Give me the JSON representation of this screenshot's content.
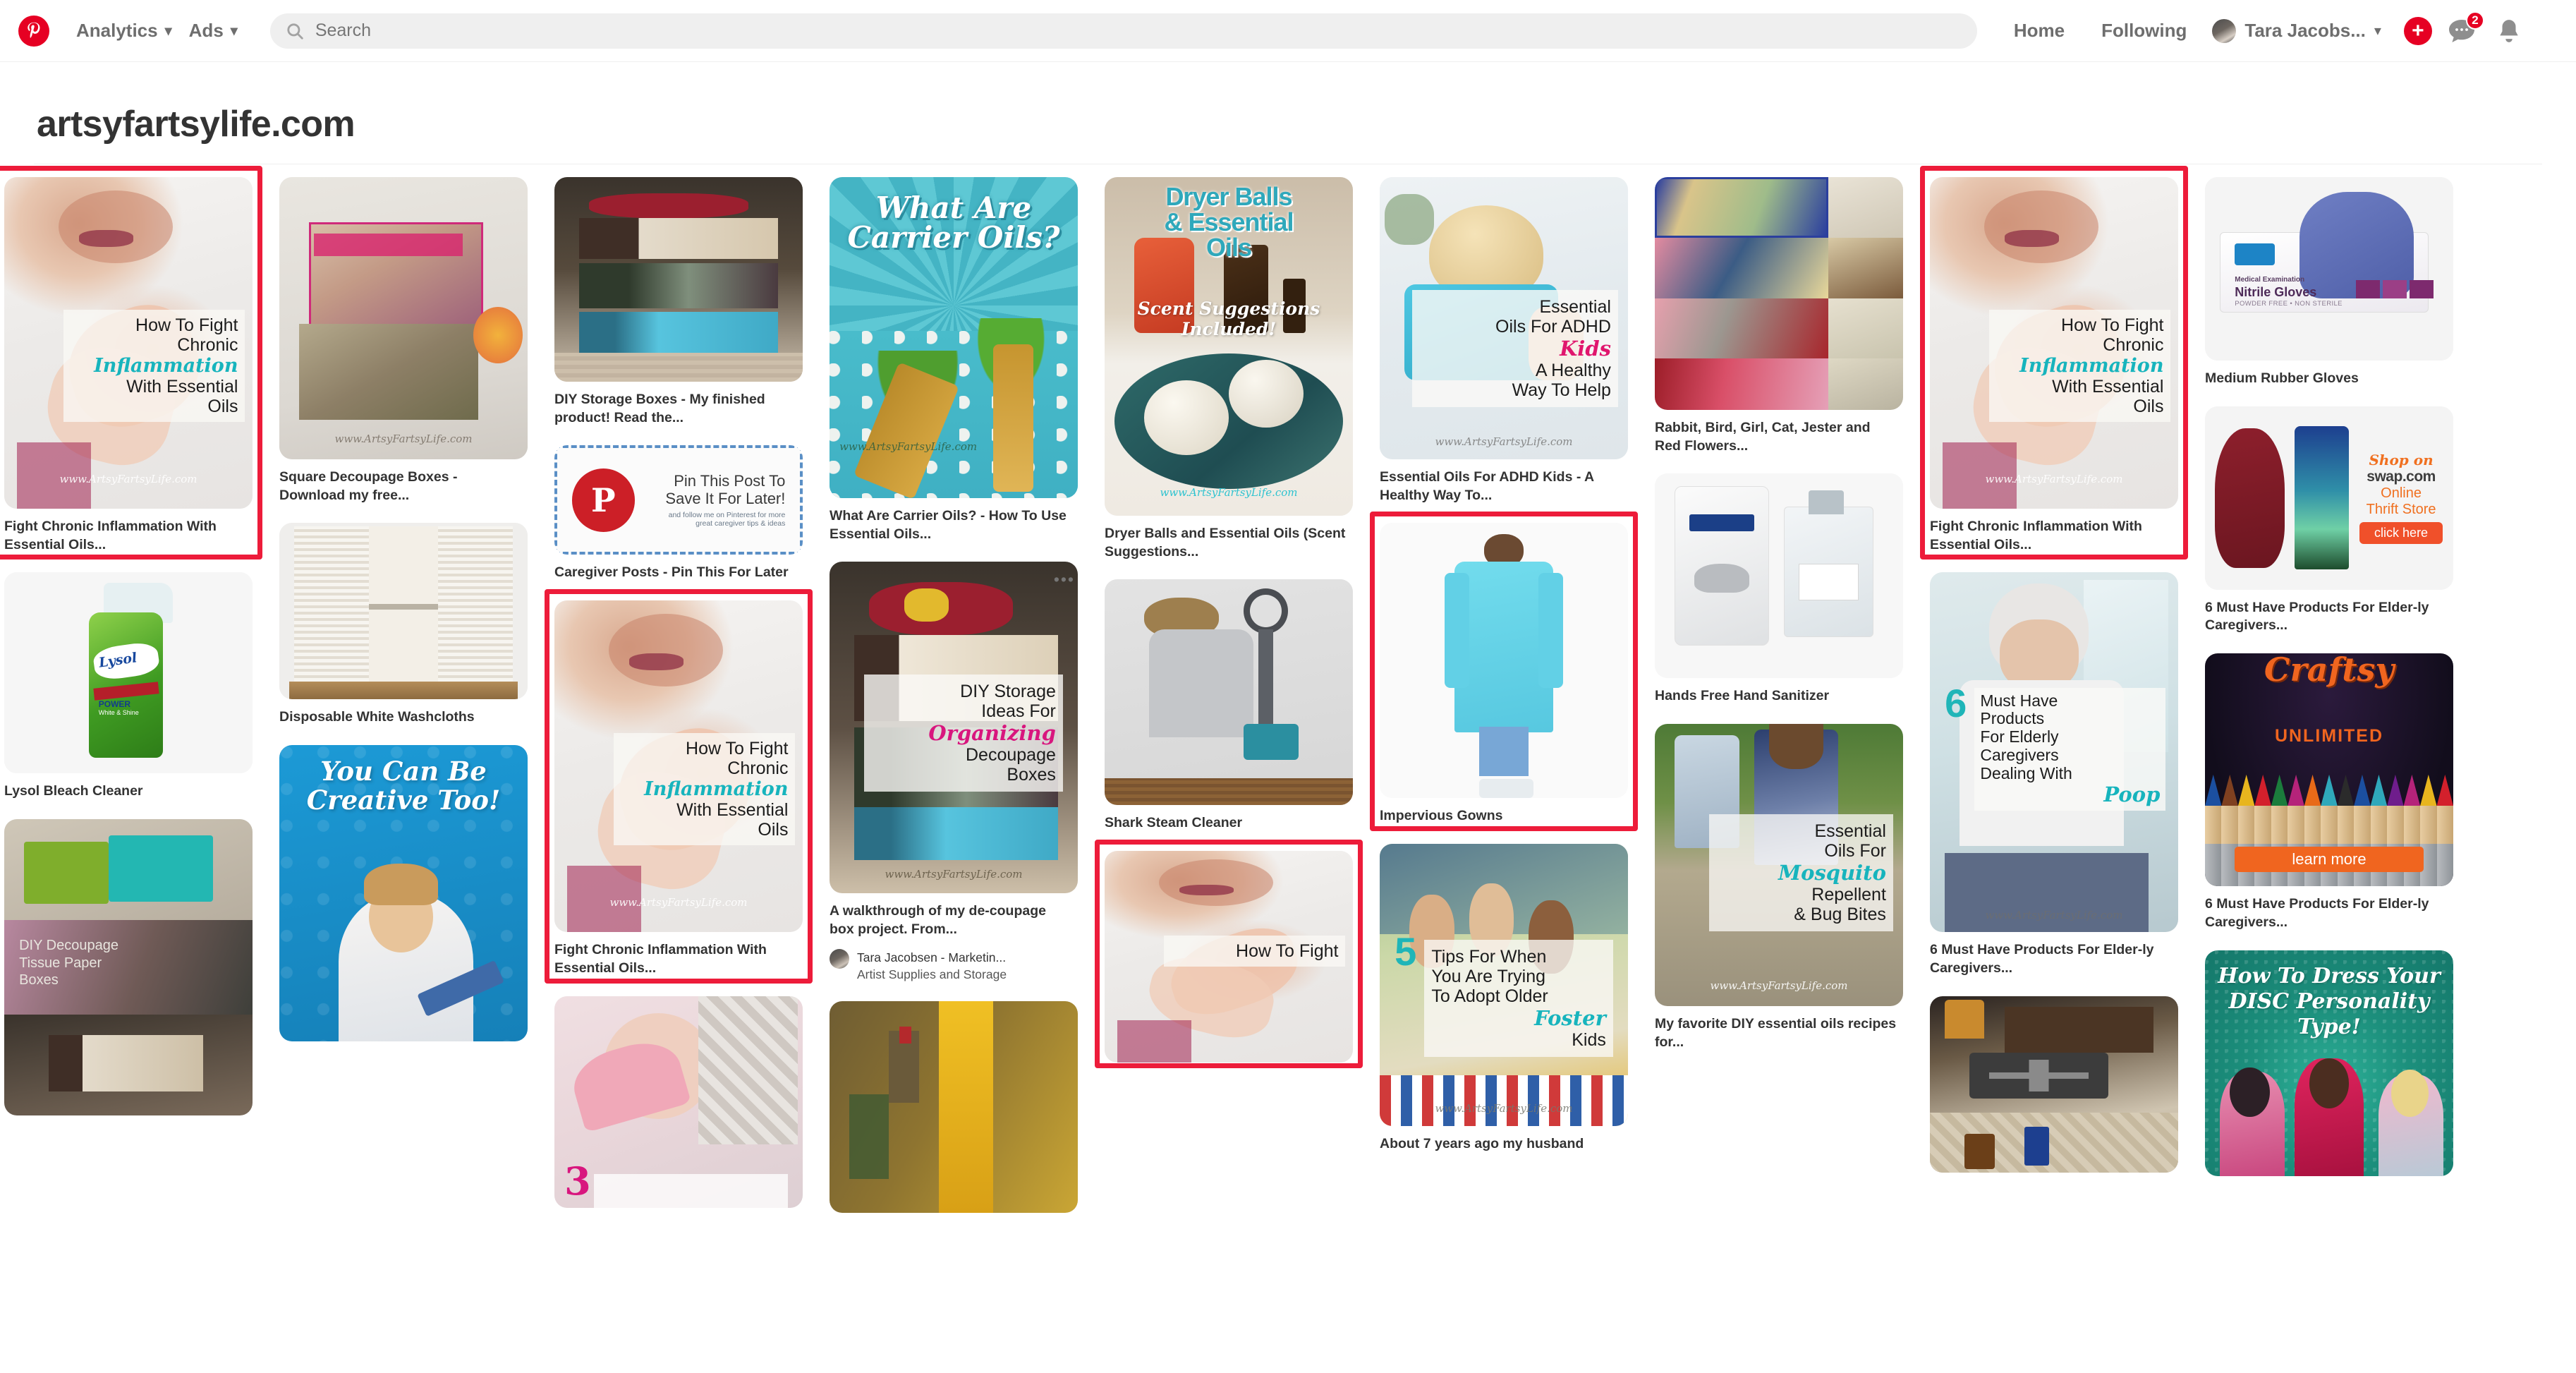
{
  "header": {
    "logo_alt": "Pinterest",
    "nav": [
      {
        "label": "Analytics",
        "has_caret": true
      },
      {
        "label": "Ads",
        "has_caret": true
      }
    ],
    "search": {
      "placeholder": "Search",
      "value": ""
    },
    "right_links": [
      "Home",
      "Following"
    ],
    "account": {
      "name": "Tara Jacobs...",
      "has_caret": true
    },
    "create_button_label": "+",
    "messages_badge": "2"
  },
  "board": {
    "title": "artsyfartsylife.com"
  },
  "columns": [
    {
      "pins": [
        {
          "title": "Fight Chronic Inflammation With Essential Oils...",
          "art": "inflammation",
          "highlight": "outer",
          "overlay": {
            "line1": "How To Fight",
            "line2": "Chronic",
            "script": "Inflammation",
            "line3": "With Essential",
            "line4": "Oils",
            "watermark": "www.ArtsyFartsyLife.com"
          }
        },
        {
          "title": "Lysol Bleach Cleaner",
          "art": "lysol"
        },
        {
          "title": "",
          "art": "decoupage-tissue"
        }
      ]
    },
    {
      "pins": [
        {
          "title": "Square Decoupage Boxes - Download my free...",
          "art": "square-boxes"
        },
        {
          "title": "Disposable White Washcloths",
          "art": "washcloths"
        },
        {
          "title": "",
          "art": "creative-too",
          "overlay": {
            "script": "You Can Be Creative Too!"
          }
        }
      ]
    },
    {
      "pins": [
        {
          "title": "DIY Storage Boxes - My finished product! Read the...",
          "art": "storage-boxes"
        },
        {
          "title": "Caregiver Posts - Pin This For Later",
          "art": "pin-this",
          "overlay": {
            "line1": "Pin This Post To",
            "line2": "Save It For Later!",
            "sub1": "and follow me on Pinterest for more",
            "sub2": "great caregiver tips & ideas"
          }
        },
        {
          "title": "Fight Chronic Inflammation With Essential Oils...",
          "art": "inflammation",
          "highlight": "outer",
          "overlay": {
            "line1": "How To Fight",
            "line2": "Chronic",
            "script": "Inflammation",
            "line3": "With Essential",
            "line4": "Oils",
            "watermark": "www.ArtsyFartsyLife.com"
          }
        },
        {
          "title": "",
          "art": "essential-3"
        }
      ]
    },
    {
      "pins": [
        {
          "title": "What Are Carrier Oils? - How To Use Essential Oils...",
          "art": "carrier-oils",
          "overlay": {
            "script": "What Are Carrier Oils?",
            "watermark": "www.ArtsyFartsyLife.com"
          }
        },
        {
          "title": "A walkthrough of my de-coupage box project. From...",
          "art": "diy-storage-ideas",
          "has_dots": true,
          "attribution": {
            "name": "Tara Jacobsen - Marketin...",
            "board": "Artist Supplies and Storage"
          },
          "overlay": {
            "line1": "DIY Storage",
            "line2": "Ideas For",
            "script": "Organizing",
            "line3": "Decoupage",
            "line4": "Boxes",
            "watermark": "www.ArtsyFartsyLife.com"
          }
        },
        {
          "title": "",
          "art": "shelf-bottles"
        }
      ]
    },
    {
      "pins": [
        {
          "title": "Dryer Balls and Essential Oils (Scent Suggestions...",
          "art": "dryer-balls",
          "overlay": {
            "line1": "Dryer Balls",
            "line2": "& Essential",
            "line3": "Oils",
            "script": "Scent Suggestions Included!",
            "watermark": "www.ArtsyFartsyLife.com"
          }
        },
        {
          "title": "Shark Steam Cleaner",
          "art": "shark"
        },
        {
          "title": "",
          "art": "inflammation",
          "highlight": "outer",
          "overlay": {
            "line1": "How To Fight"
          }
        }
      ]
    },
    {
      "pins": [
        {
          "title": "Essential Oils For ADHD Kids - A Healthy Way To...",
          "art": "adhd",
          "overlay": {
            "line1": "Essential",
            "line2": "Oils For ADHD",
            "script": "Kids",
            "line3": "A Healthy",
            "line4": "Way To Help",
            "watermark": "www.ArtsyFartsyLife.com"
          }
        },
        {
          "title": "Impervious Gowns",
          "art": "gown",
          "highlight": "outer"
        },
        {
          "title": "About 7 years ago my husband",
          "art": "foster-kids",
          "overlay": {
            "big": "5",
            "line1": "Tips For When",
            "line2": "You Are Trying",
            "line3": "To Adopt Older",
            "script": "Foster",
            "line4": "Kids",
            "watermark": "www.ArtsyFartsyLife.com"
          }
        }
      ]
    },
    {
      "pins": [
        {
          "title": "Rabbit, Bird, Girl, Cat, Jester and Red Flowers...",
          "art": "collage"
        },
        {
          "title": "Hands Free Hand Sanitizer",
          "art": "purell"
        },
        {
          "title": "My favorite DIY essential oils recipes for...",
          "art": "mosquito",
          "overlay": {
            "line1": "Essential",
            "line2": "Oils For",
            "script": "Mosquito",
            "line3": "Repellent",
            "line4": "& Bug Bites",
            "watermark": "www.ArtsyFartsyLife.com"
          }
        }
      ]
    },
    {
      "pins": [
        {
          "title": "Fight Chronic Inflammation With Essential Oils...",
          "art": "inflammation",
          "highlight": "outer",
          "overlay": {
            "line1": "How To Fight",
            "line2": "Chronic",
            "script": "Inflammation",
            "line3": "With Essential",
            "line4": "Oils",
            "watermark": "www.ArtsyFartsyLife.com"
          }
        },
        {
          "title": "6 Must Have Products For Elder-ly Caregivers...",
          "art": "poop",
          "overlay": {
            "big": "6",
            "line1": "Must Have",
            "line2": "Products",
            "line3": "For Elderly",
            "line4": "Caregivers",
            "line5": "Dealing With",
            "script": "Poop",
            "watermark": "www.ArtsyFartsyLife.com"
          }
        },
        {
          "title": "",
          "art": "bedroom-oils"
        }
      ]
    },
    {
      "pins": [
        {
          "title": "Medium Rubber Gloves",
          "art": "gloves"
        },
        {
          "title": "6 Must Have Products For Elder-ly Caregivers...",
          "art": "swap-ad",
          "overlay": {
            "line1": "Shop on",
            "line2": "swap.com",
            "line3": "Online",
            "line4": "Thrift Store",
            "button": "click here"
          }
        },
        {
          "title": "6 Must Have Products For Elder-ly Caregivers...",
          "art": "craftsy",
          "overlay": {
            "line1": "Craftsy",
            "line2": "UNLIMITED",
            "button": "learn more"
          }
        },
        {
          "title": "",
          "art": "disc",
          "overlay": {
            "script": "How To Dress Your DISC Personality Type!"
          }
        }
      ]
    }
  ],
  "colors": {
    "brand_red": "#e60023",
    "highlight_red": "#ed1c3a",
    "text_dark": "#333333",
    "text_muted": "#6e6e6e",
    "search_bg": "#efefef"
  }
}
